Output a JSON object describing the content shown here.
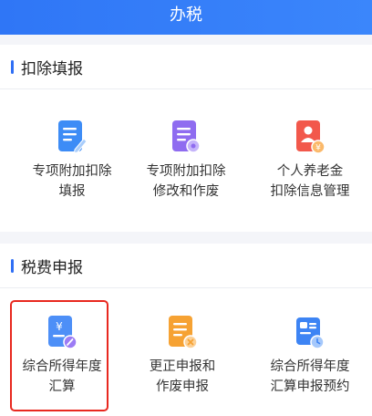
{
  "header": {
    "title": "办税"
  },
  "sections": [
    {
      "title": "扣除填报",
      "items": [
        {
          "line1": "专项附加扣除",
          "line2": "填报",
          "icon": "document-edit-icon"
        },
        {
          "line1": "专项附加扣除",
          "line2": "修改和作废",
          "icon": "document-settings-icon"
        },
        {
          "line1": "个人养老金",
          "line2": "扣除信息管理",
          "icon": "pension-document-icon"
        }
      ]
    },
    {
      "title": "税费申报",
      "items": [
        {
          "line1": "综合所得年度",
          "line2": "汇算",
          "icon": "yen-document-icon"
        },
        {
          "line1": "更正申报和",
          "line2": "作废申报",
          "icon": "document-cancel-icon"
        },
        {
          "line1": "综合所得年度",
          "line2": "汇算申报预约",
          "icon": "calendar-clock-icon"
        }
      ]
    }
  ],
  "colors": {
    "accent": "#2f76f6",
    "highlight": "#e8281f"
  }
}
